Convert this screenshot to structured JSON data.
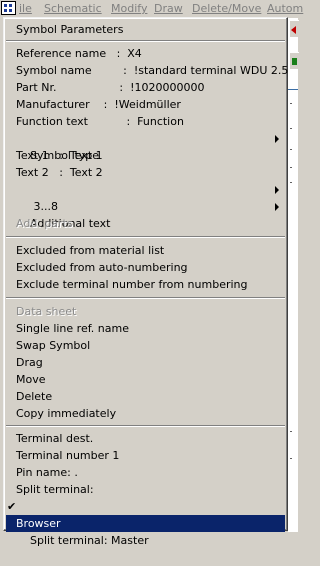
{
  "menubar": {
    "items": [
      "ile",
      "Schematic",
      "Modify",
      "Draw",
      "Delete/Move",
      "Autom"
    ]
  },
  "menu": {
    "title": "Symbol Parameters",
    "group1": [
      {
        "label": "Reference name   :  X4",
        "arrow": false
      },
      {
        "label": "Symbol name         :  !standard terminal WDU 2.5",
        "arrow": false
      },
      {
        "label": "Part Nr.                  :  !1020000000",
        "arrow": false
      },
      {
        "label": "Manufacturer    :  !Weidmüller",
        "arrow": false
      },
      {
        "label": "Function text           :  Function",
        "arrow": false
      },
      {
        "label": "Symbol type",
        "arrow": true
      },
      {
        "label": "Text 1   :  Text 1",
        "arrow": false
      },
      {
        "label": "Text 2   :  Text 2",
        "arrow": false
      },
      {
        "label": " 3...8",
        "arrow": true
      },
      {
        "label": "Additional text",
        "arrow": true
      },
      {
        "label": "Add. parts",
        "arrow": false,
        "disabled": true
      }
    ],
    "group2": [
      {
        "label": "Excluded from material list"
      },
      {
        "label": "Excluded from auto-numbering"
      },
      {
        "label": "Exclude terminal number from numbering"
      }
    ],
    "group3": [
      {
        "label": "Data sheet",
        "disabled": true
      },
      {
        "label": "Single line ref. name"
      },
      {
        "label": "Swap Symbol"
      },
      {
        "label": "Drag"
      },
      {
        "label": "Move"
      },
      {
        "label": "Delete"
      },
      {
        "label": "Copy immediately"
      }
    ],
    "group4": [
      {
        "label": "Terminal dest."
      },
      {
        "label": "Terminal number 1"
      },
      {
        "label": "Pin name: ."
      },
      {
        "label": "Split terminal:"
      },
      {
        "label": "Split terminal: Master",
        "checked": true
      },
      {
        "label": "Browser",
        "selected": true
      }
    ],
    "check_glyph": "✔"
  }
}
